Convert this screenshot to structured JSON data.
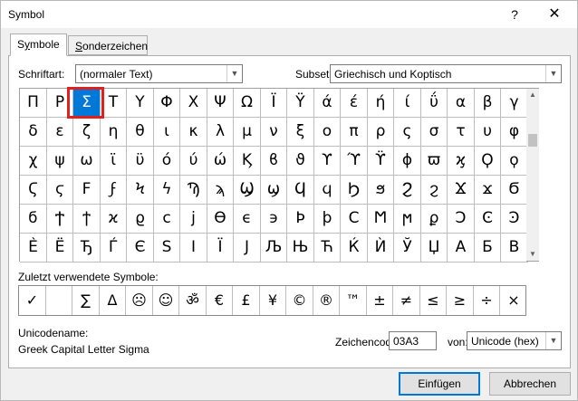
{
  "window": {
    "title": "Symbol",
    "help": "?",
    "close": "✕"
  },
  "tabs": [
    {
      "label": "Symbole",
      "accel": "y",
      "pre": "S",
      "post": "mbole"
    },
    {
      "label": "Sonderzeichen",
      "pre": "",
      "accel": "S",
      "post": "onderzeichen"
    }
  ],
  "font": {
    "label": "Schriftart:",
    "value": "(normaler Text)"
  },
  "subset": {
    "label": "Subset:",
    "value": "Griechisch und Koptisch"
  },
  "symbols": [
    [
      "Π",
      "Ρ",
      "Σ",
      "Τ",
      "Υ",
      "Φ",
      "Χ",
      "Ψ",
      "Ω",
      "Ϊ",
      "Ϋ",
      "ά",
      "έ",
      "ή",
      "ί",
      "ΰ",
      "α",
      "β",
      "γ"
    ],
    [
      "δ",
      "ε",
      "ζ",
      "η",
      "θ",
      "ι",
      "κ",
      "λ",
      "μ",
      "ν",
      "ξ",
      "ο",
      "π",
      "ρ",
      "ς",
      "σ",
      "τ",
      "υ",
      "φ"
    ],
    [
      "χ",
      "ψ",
      "ω",
      "ϊ",
      "ϋ",
      "ό",
      "ύ",
      "ώ",
      "Ϗ",
      "ϐ",
      "ϑ",
      "ϒ",
      "ϓ",
      "ϔ",
      "ϕ",
      "ϖ",
      "ϗ",
      "Ϙ",
      "ϙ"
    ],
    [
      "Ϛ",
      "ϛ",
      "Ϝ",
      "ϝ",
      "Ϟ",
      "ϟ",
      "Ϡ",
      "ϡ",
      "Ϣ",
      "ϣ",
      "Ϥ",
      "ϥ",
      "Ϧ",
      "ϧ",
      "Ϩ",
      "ϩ",
      "Ϫ",
      "ϫ",
      "Ϭ"
    ],
    [
      "ϭ",
      "Ϯ",
      "ϯ",
      "ϰ",
      "ϱ",
      "ϲ",
      "ϳ",
      "ϴ",
      "ϵ",
      "϶",
      "Ϸ",
      "ϸ",
      "Ϲ",
      "Ϻ",
      "ϻ",
      "ϼ",
      "Ͻ",
      "Ͼ",
      "Ͽ"
    ],
    [
      "Ѐ",
      "Ё",
      "Ђ",
      "Ѓ",
      "Є",
      "Ѕ",
      "І",
      "Ї",
      "Ј",
      "Љ",
      "Њ",
      "Ћ",
      "Ќ",
      "Ѝ",
      "Ў",
      "Џ",
      "А",
      "Б",
      "В"
    ]
  ],
  "selected": {
    "row": 0,
    "col": 2
  },
  "recent": {
    "label": "Zuletzt verwendete Symbole:",
    "items": [
      "✓",
      "",
      "∑",
      "Δ",
      "☹",
      "☺",
      "ॐ",
      "€",
      "£",
      "¥",
      "©",
      "®",
      "™",
      "±",
      "≠",
      "≤",
      "≥",
      "÷",
      "×"
    ]
  },
  "unicode_name": {
    "label": "Unicodename:",
    "value": "Greek Capital Letter Sigma"
  },
  "charcode": {
    "label": "Zeichencode:",
    "value": "03A3"
  },
  "from": {
    "label": "von:",
    "value": "Unicode (hex)"
  },
  "buttons": {
    "insert": "Einfügen",
    "cancel": "Abbrechen"
  }
}
